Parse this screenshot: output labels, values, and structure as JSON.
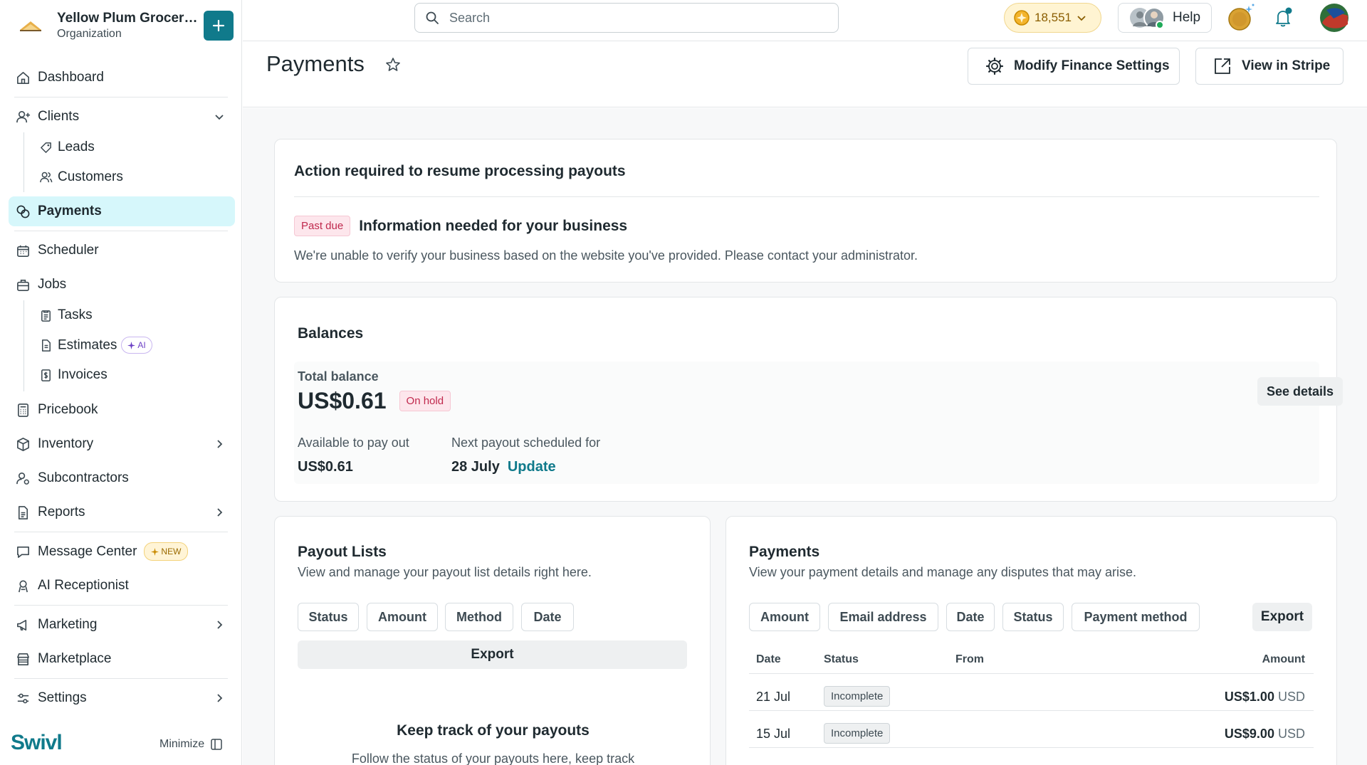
{
  "org": {
    "name": "Yellow Plum Grocers...",
    "subtitle": "Organization"
  },
  "sidebar": {
    "dashboard": "Dashboard",
    "clients": "Clients",
    "leads": "Leads",
    "customers": "Customers",
    "payments": "Payments",
    "scheduler": "Scheduler",
    "jobs": "Jobs",
    "tasks": "Tasks",
    "estimates": "Estimates",
    "estimates_badge": "AI",
    "invoices": "Invoices",
    "pricebook": "Pricebook",
    "inventory": "Inventory",
    "subcontractors": "Subcontractors",
    "reports": "Reports",
    "message_center": "Message Center",
    "message_center_badge": "NEW",
    "ai_receptionist": "AI Receptionist",
    "marketing": "Marketing",
    "marketplace": "Marketplace",
    "settings": "Settings",
    "brand": "Swivl",
    "minimize": "Minimize"
  },
  "topbar": {
    "search_placeholder": "Search",
    "coins": "18,551",
    "help": "Help"
  },
  "page": {
    "title": "Payments",
    "modify_settings": "Modify Finance Settings",
    "view_stripe": "View in Stripe"
  },
  "action": {
    "title": "Action required to resume processing payouts",
    "badge": "Past due",
    "heading": "Information needed for your business",
    "message": "We're unable to verify your business based on the website you've provided. Please contact your administrator."
  },
  "balances": {
    "title": "Balances",
    "total_label": "Total balance",
    "total_value": "US$0.61",
    "hold_badge": "On hold",
    "see_details": "See details",
    "available_label": "Available to pay out",
    "available_value": "US$0.61",
    "next_label": "Next payout scheduled for",
    "next_date": "28 July",
    "update": "Update"
  },
  "payout_lists": {
    "title": "Payout Lists",
    "subtitle": "View and manage your payout list details right here.",
    "filters": [
      "Status",
      "Amount",
      "Method",
      "Date"
    ],
    "export": "Export",
    "empty_title": "Keep track of your payouts",
    "empty_text": "Follow the status of your payouts here, keep track"
  },
  "payments_card": {
    "title": "Payments",
    "subtitle": "View your payment details and manage any disputes that may arise.",
    "filters": [
      "Amount",
      "Email address",
      "Date",
      "Status",
      "Payment method"
    ],
    "export": "Export",
    "columns": [
      "Date",
      "Status",
      "From",
      "Amount"
    ],
    "rows": [
      {
        "date": "21 Jul",
        "status": "Incomplete",
        "from": "",
        "amount": "US$1.00",
        "currency": "USD"
      },
      {
        "date": "15 Jul",
        "status": "Incomplete",
        "from": "",
        "amount": "US$9.00",
        "currency": "USD"
      }
    ]
  },
  "colors": {
    "accent": "#107a8b",
    "active_bg": "#d6f7fb",
    "danger": "#c0294d"
  }
}
